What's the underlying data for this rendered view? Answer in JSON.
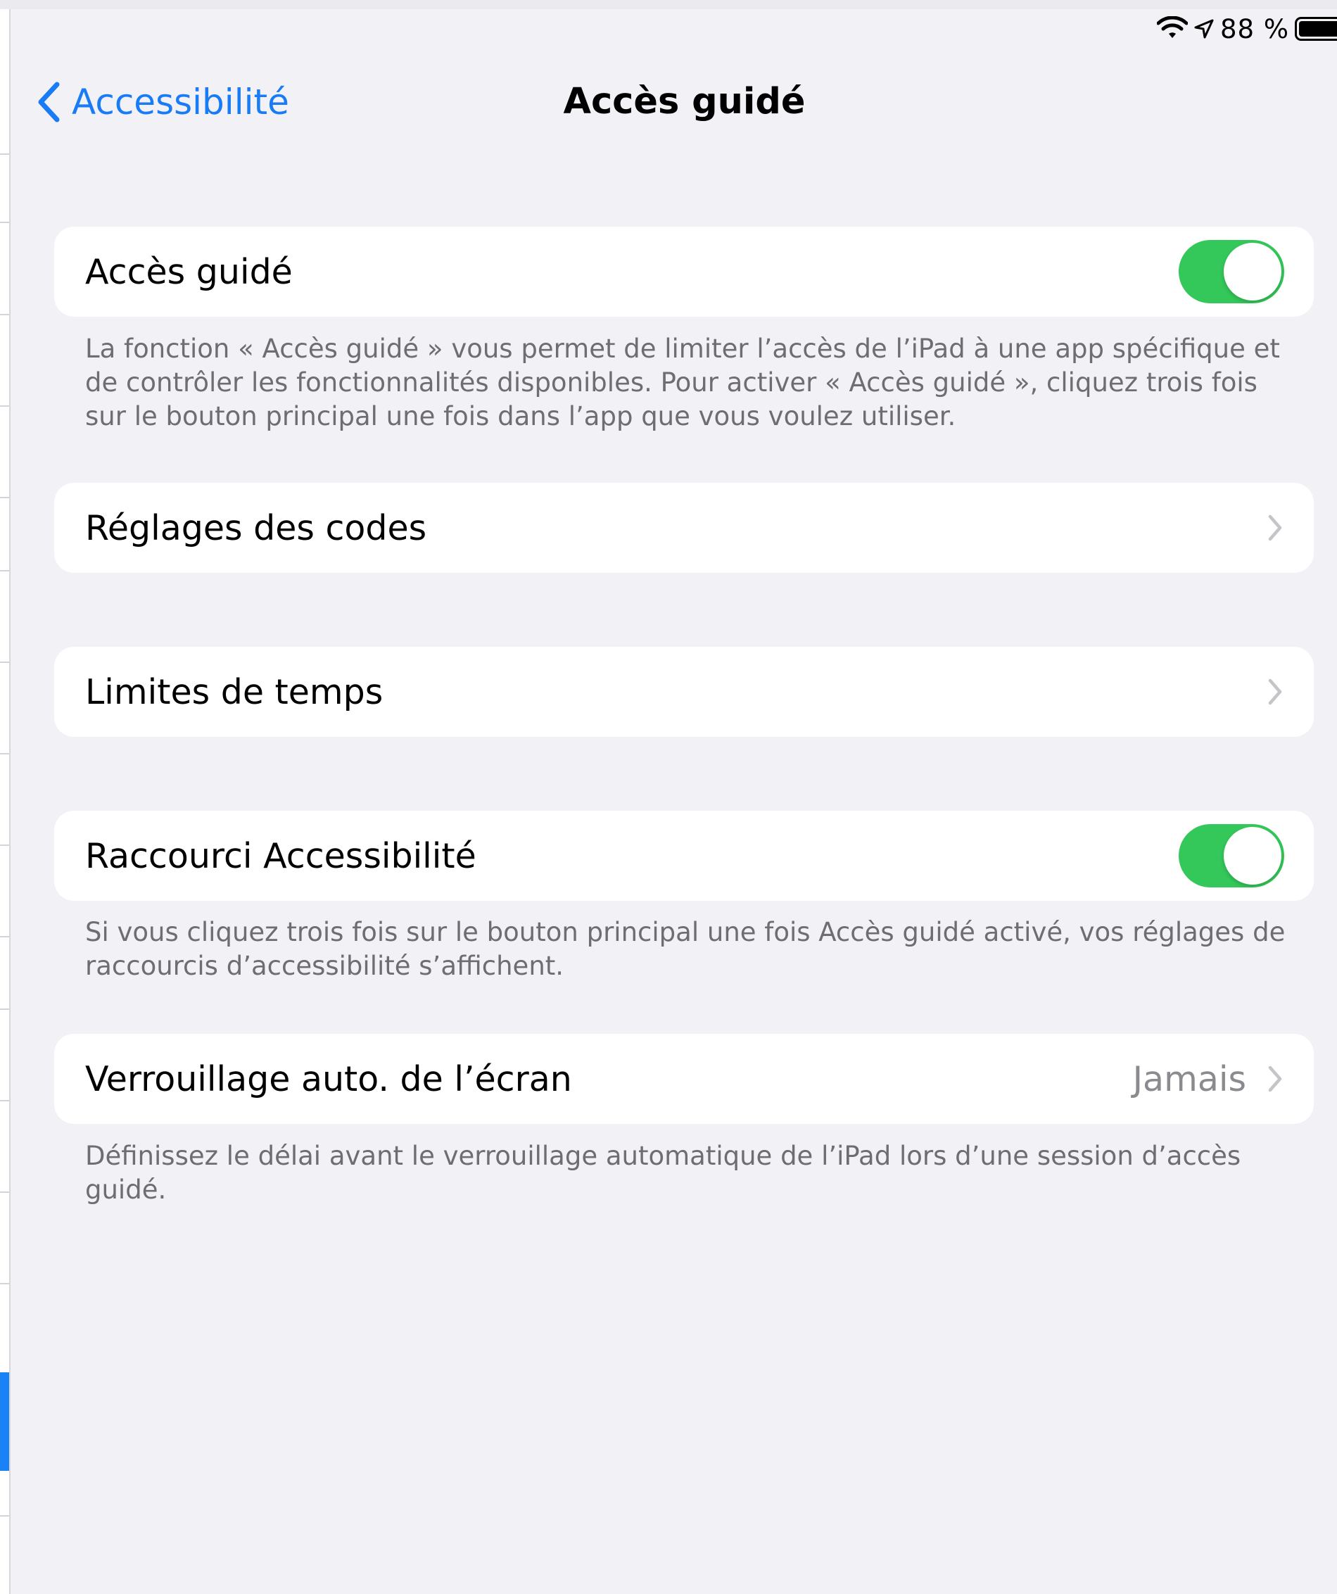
{
  "status_bar": {
    "battery_percent": "88 %",
    "icons": [
      "wifi-icon",
      "location-arrow-icon",
      "battery-icon"
    ]
  },
  "nav": {
    "back_label": "Accessibilité",
    "title": "Accès guidé"
  },
  "sections": {
    "guided_access": {
      "label": "Accès guidé",
      "toggle_on": true,
      "footer": "La fonction « Accès guidé » vous permet de limiter l’accès de l’iPad à une app spécifique et de contrôler les fonctionnalités disponibles. Pour activer « Accès guidé », cliquez trois fois sur le bouton principal une fois dans l’app que vous voulez utiliser."
    },
    "passcode": {
      "label": "Réglages des codes"
    },
    "time_limits": {
      "label": "Limites de temps"
    },
    "shortcut": {
      "label": "Raccourci Accessibilité",
      "toggle_on": true,
      "footer": "Si vous cliquez trois fois sur le bouton principal une fois Accès guidé activé, vos réglages de raccourcis d’accessibilité s’affichent."
    },
    "auto_lock": {
      "label": "Verrouillage auto. de l’écran",
      "value": "Jamais",
      "footer": "Définissez le délai avant le verrouillage automatique de l’iPad lors d’une session d’accès guidé."
    }
  },
  "colors": {
    "tint": "#1a7cf5",
    "toggle_on": "#34c759",
    "background": "#f1f1f6",
    "footer_text": "#6d6d72"
  }
}
